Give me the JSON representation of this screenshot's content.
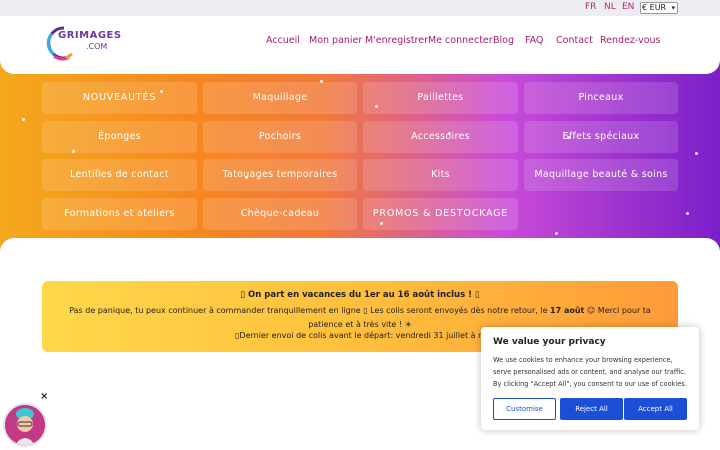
{
  "langbar": {
    "languages": [
      "FR",
      "NL",
      "EN"
    ],
    "currency": "€ EUR"
  },
  "header": {
    "logo_top": "GRIMAGES",
    "logo_bottom": ".COM",
    "nav": [
      "Accueil",
      "Mon panier",
      "M'enregistrer",
      "Me connecter",
      "Blog",
      "FAQ",
      "Contact",
      "Rendez-vous"
    ]
  },
  "categories": [
    "NOUVEAUTÉS",
    "Maquillage",
    "Paillettes",
    "Pinceaux",
    "Éponges",
    "Pochoirs",
    "Accessoires",
    "Effets spéciaux",
    "Lentilles de contact",
    "Tatouages temporaires",
    "Kits",
    "Maquillage beauté & soins",
    "Formations et ateliers",
    "Chèque-cadeau",
    "PROMOS & DESTOCKAGE"
  ],
  "notice": {
    "line1": "▯ On part en vacances du 1er au 16 août inclus ! ▯",
    "line2_a": "Pas de panique, tu peux continuer à commander tranquillement en ligne ▯ Les colis seront envoyés dès notre retour, le ",
    "line2_b": "17 août",
    "line2_c": " ☺ Merci pour ta patience et à très vite ! ☀",
    "line3": "▯Dernier envoi de colis avant le départ: vendredi 31 juillet à midi"
  },
  "cookie": {
    "title": "We value your privacy",
    "description": "We use cookies to enhance your browsing experience, serve personalised ads or content, and analyse our traffic. By clicking \"Accept All\", you consent to our use of cookies.",
    "customise": "Customise",
    "reject": "Reject All",
    "accept": "Accept All"
  },
  "widget": {
    "close": "×"
  },
  "colors": {
    "accent": "#a11f6e",
    "button_blue": "#1d4fd6"
  }
}
